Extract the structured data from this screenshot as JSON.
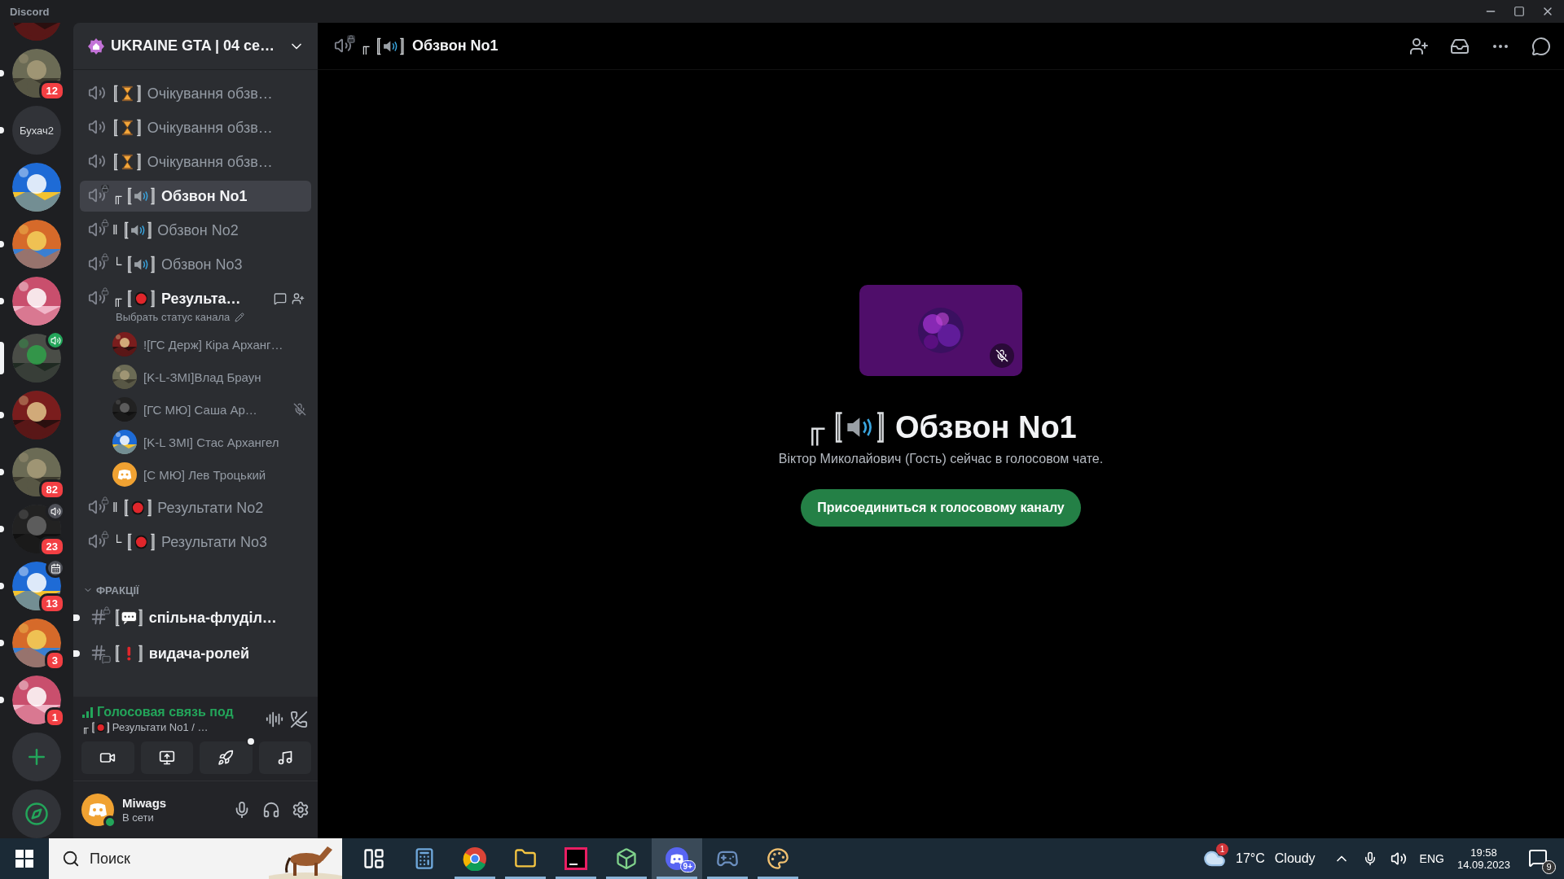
{
  "window": {
    "title": "Discord"
  },
  "servers": [
    {
      "kind": "picture",
      "unread": false,
      "selected": false
    },
    {
      "kind": "picture",
      "unread": true,
      "selected": false,
      "badge": "12"
    },
    {
      "kind": "text",
      "label": "Бухач2",
      "unread": true,
      "selected": false
    },
    {
      "kind": "picture",
      "unread": false,
      "selected": false
    },
    {
      "kind": "picture",
      "unread": true,
      "selected": false
    },
    {
      "kind": "picture",
      "unread": true,
      "selected": false
    },
    {
      "kind": "picture",
      "unread": false,
      "selected": true,
      "activity": {
        "kind": "voice-live"
      }
    },
    {
      "kind": "picture",
      "unread": true,
      "selected": false
    },
    {
      "kind": "picture",
      "unread": true,
      "selected": false,
      "badge": "82"
    },
    {
      "kind": "picture",
      "unread": true,
      "selected": false,
      "badge": "23",
      "activity": {
        "kind": "voice"
      }
    },
    {
      "kind": "picture",
      "unread": true,
      "selected": false,
      "badge": "13",
      "activity": {
        "kind": "event"
      }
    },
    {
      "kind": "picture",
      "unread": true,
      "selected": false,
      "badge": "3"
    },
    {
      "kind": "picture",
      "unread": true,
      "selected": false,
      "badge": "1"
    }
  ],
  "server_header": {
    "name": "UKRAINE GTA | 04 се…"
  },
  "channels": [
    {
      "kind": "voice",
      "locked": false,
      "emblem": {
        "kind": "hourglass"
      },
      "name": "Очікування обзв…",
      "selected": false
    },
    {
      "kind": "voice",
      "locked": false,
      "emblem": {
        "kind": "hourglass"
      },
      "name": "Очікування обзв…",
      "selected": false
    },
    {
      "kind": "voice",
      "locked": false,
      "emblem": {
        "kind": "hourglass"
      },
      "name": "Очікування обзв…",
      "selected": false
    },
    {
      "kind": "voice",
      "locked": true,
      "prefix": "╓",
      "emblem": {
        "kind": "speaker"
      },
      "name": "Обзвон No1",
      "selected": true
    },
    {
      "kind": "voice",
      "locked": true,
      "prefix": "‖",
      "emblem": {
        "kind": "speaker"
      },
      "name": "Обзвон No2",
      "selected": false
    },
    {
      "kind": "voice",
      "locked": true,
      "prefix": "└",
      "emblem": {
        "kind": "speaker"
      },
      "name": "Обзвон No3",
      "selected": false
    },
    {
      "kind": "voice",
      "locked": true,
      "prefix": "╓",
      "emblem": {
        "kind": "record"
      },
      "name": "Результа…",
      "selected": false,
      "connected": true,
      "status_hint": "Выбрать статус канала",
      "members": [
        {
          "name": "![ГС Держ] Кіра Арханг…",
          "avatar": {
            "kind": "picture"
          },
          "muted": false
        },
        {
          "name": "[K-L-ЗМІ]Влад Браун",
          "avatar": {
            "kind": "picture"
          },
          "muted": false
        },
        {
          "name": "[ГС МЮ] Саша Ар…",
          "avatar": {
            "kind": "picture"
          },
          "muted": true
        },
        {
          "name": "[K-L ЗМІ] Стас Архангел",
          "avatar": {
            "kind": "picture"
          },
          "muted": false
        },
        {
          "name": "[С МЮ] Лев Троцький",
          "avatar": {
            "kind": "default"
          },
          "muted": false
        }
      ]
    },
    {
      "kind": "voice",
      "locked": true,
      "prefix": "‖",
      "emblem": {
        "kind": "record"
      },
      "name": "Результати No2",
      "selected": false
    },
    {
      "kind": "voice",
      "locked": true,
      "prefix": "└",
      "emblem": {
        "kind": "record"
      },
      "name": "Результати No3",
      "selected": false
    },
    {
      "kind": "category",
      "name": "ФРАКЦІЇ",
      "expanded": true
    },
    {
      "kind": "text",
      "locked": true,
      "emblem": {
        "kind": "speech"
      },
      "name": "спільна-флуділ…",
      "unread": true
    },
    {
      "kind": "forum",
      "locked": false,
      "emblem": {
        "kind": "exclamation"
      },
      "name": "видача-ролей",
      "unread": true
    }
  ],
  "voice_panel": {
    "status": "Голосовая связь под",
    "prefix": "╓",
    "emblem": {
      "kind": "record"
    },
    "channel": "Результати No1 / …",
    "buttons": [
      {
        "kind": "camera",
        "notify": false
      },
      {
        "kind": "screen",
        "notify": false
      },
      {
        "kind": "activity",
        "notify": true
      },
      {
        "kind": "soundboard",
        "notify": false
      }
    ]
  },
  "user": {
    "name": "Miwags",
    "status": "В сети",
    "online": true
  },
  "main": {
    "header": {
      "prefix": "╓",
      "emblem": {
        "kind": "speaker"
      },
      "name": "Обзвон No1"
    },
    "tile": {
      "muted": true
    },
    "title": {
      "prefix": "╓",
      "emblem": {
        "kind": "speaker"
      },
      "name": "Обзвон No1"
    },
    "subtitle": "Віктор Миколайович (Гость) сейчас в голосовом чате.",
    "join_button": "Присоединиться к голосовому каналу"
  },
  "taskbar": {
    "search_placeholder": "Поиск",
    "apps": [
      {
        "kind": "taskview",
        "running": false,
        "active": false
      },
      {
        "kind": "calculator",
        "running": false,
        "active": false
      },
      {
        "kind": "chrome",
        "running": true,
        "active": false
      },
      {
        "kind": "explorer",
        "running": true,
        "active": false
      },
      {
        "kind": "ide",
        "running": true,
        "active": false
      },
      {
        "kind": "cube",
        "running": true,
        "active": false
      },
      {
        "kind": "discord",
        "running": true,
        "active": true,
        "badge": "9+"
      },
      {
        "kind": "game",
        "running": true,
        "active": false
      },
      {
        "kind": "paint",
        "running": true,
        "active": false
      }
    ],
    "weather": {
      "badge": "1",
      "temp": "17°C",
      "condition": "Cloudy"
    },
    "language": "ENG",
    "time": "19:58",
    "date": "14.09.2023",
    "notifications": "9"
  }
}
